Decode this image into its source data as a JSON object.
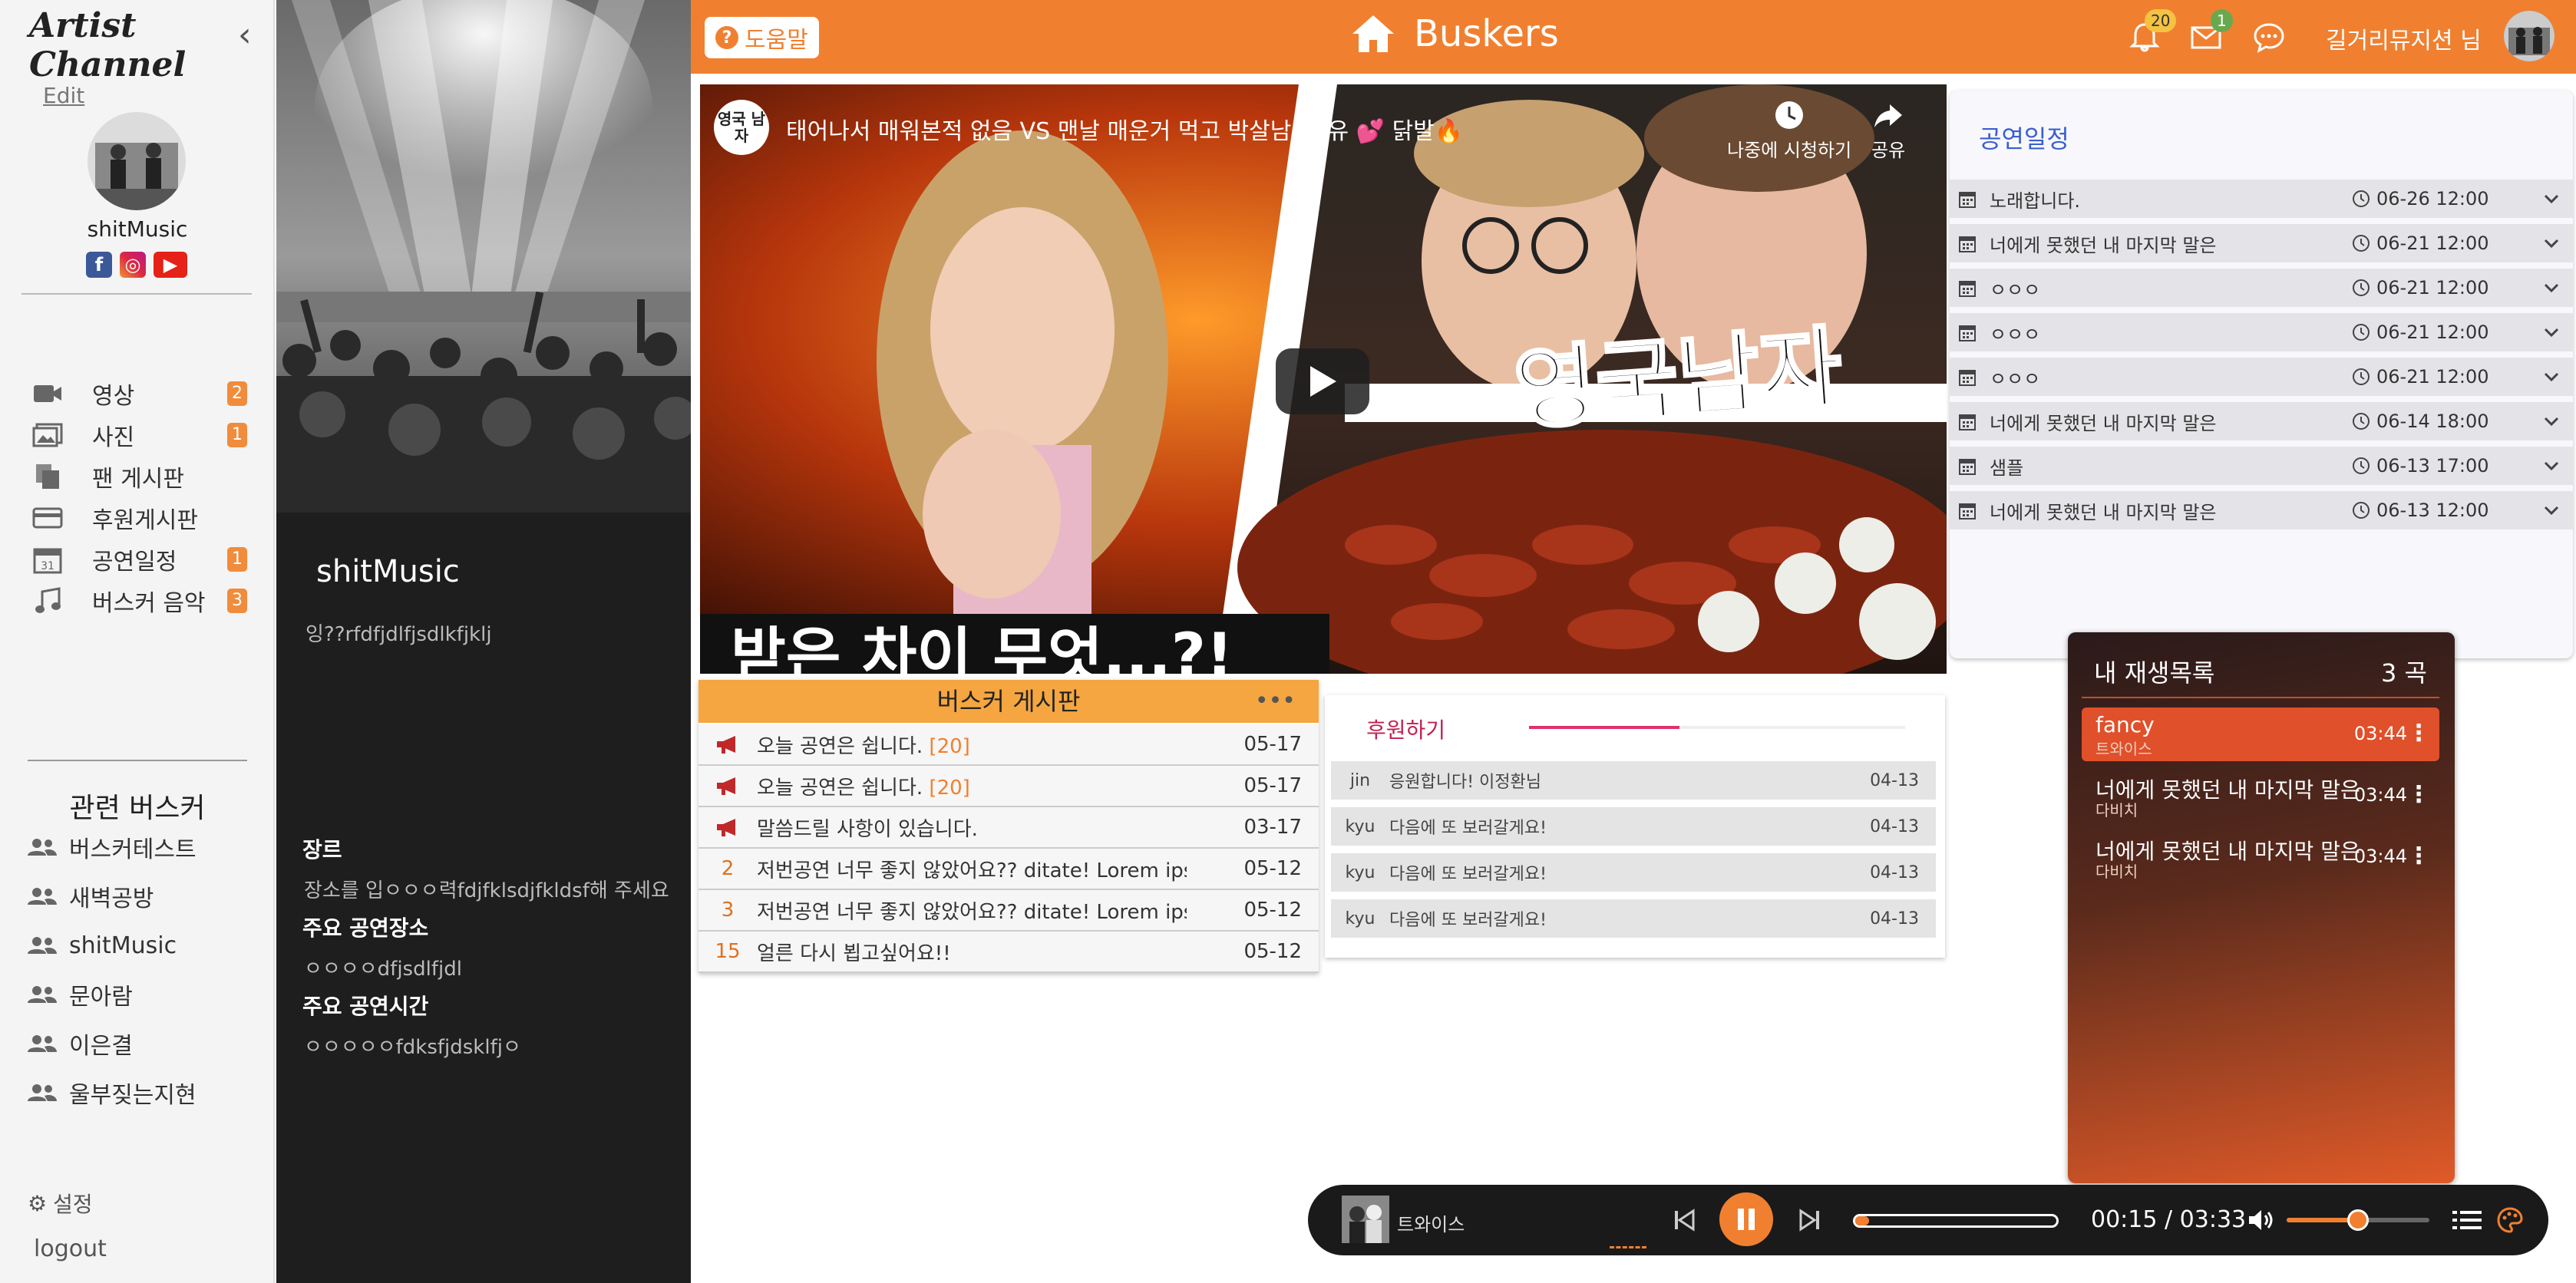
{
  "sidebar": {
    "brand": "Artist Channel",
    "edit": "Edit",
    "artist_name": "shitMusic",
    "menu": [
      {
        "label": "영상",
        "badge": "2",
        "icon": "video-icon"
      },
      {
        "label": "사진",
        "badge": "1",
        "icon": "photo-icon"
      },
      {
        "label": "팬 게시판",
        "badge": "",
        "icon": "copy-icon"
      },
      {
        "label": "후원게시판",
        "badge": "",
        "icon": "card-icon"
      },
      {
        "label": "공연일정",
        "badge": "1",
        "icon": "calendar-icon"
      },
      {
        "label": "버스커 음악",
        "badge": "3",
        "icon": "music-icon"
      }
    ],
    "related_title": "관련 버스커",
    "related": [
      "버스커테스트",
      "새벽공방",
      "shitMusic",
      "문아람",
      "이은결",
      "울부짖는지현"
    ],
    "settings": "설정",
    "logout": "logout"
  },
  "profile": {
    "name": "shitMusic",
    "desc": "잉??rfdfjdlfjsdlkfjklj",
    "genre_label": "장르",
    "genre_value": "장소를 입ㅇㅇㅇ력fdjfklsdjfkldsf해 주세요",
    "venue_label": "주요 공연장소",
    "venue_value": "ㅇㅇㅇㅇdfjsdlfjdl",
    "time_label": "주요 공연시간",
    "time_value": "ㅇㅇㅇㅇㅇfdksfjdsklfjㅇ"
  },
  "header": {
    "help": "도움말",
    "title": "Buskers",
    "notif_count": "20",
    "mail_count": "1",
    "user": "길거리뮤지션 님"
  },
  "video": {
    "channel_logo": "영국 남자",
    "title": "태어나서 매워본적 없음 VS 맨날 매운거 먹고 박살남: 소유 💕 닭발🔥",
    "watch_later": "나중에 시청하기",
    "share": "공유",
    "caption": "받은 차이 무엇...?!",
    "overlay": "영국남자"
  },
  "board": {
    "title": "버스커 게시판",
    "rows": [
      {
        "num": "",
        "notice": true,
        "title": "오늘 공연은 쉽니다.",
        "comments": "[20]",
        "date": "05-17"
      },
      {
        "num": "",
        "notice": true,
        "title": "오늘 공연은 쉽니다.",
        "comments": "[20]",
        "date": "05-17"
      },
      {
        "num": "",
        "notice": true,
        "title": "말씀드릴 사항이 있습니다.",
        "comments": "",
        "date": "03-17"
      },
      {
        "num": "2",
        "notice": false,
        "title": "저번공연 너무 좋지 않았어요?? ditate! Lorem ipsum dolor",
        "comments": "",
        "date": "05-12"
      },
      {
        "num": "3",
        "notice": false,
        "title": "저번공연 너무 좋지 않았어요?? ditate! Lorem ipsum dolor",
        "comments": "",
        "date": "05-12"
      },
      {
        "num": "15",
        "notice": false,
        "title": "얼른 다시 뵙고싶어요!!",
        "comments": "",
        "date": "05-12"
      }
    ]
  },
  "donate": {
    "title": "후원하기",
    "rows": [
      {
        "user": "jin",
        "msg": "응원합니다! 이정환님",
        "date": "04-13"
      },
      {
        "user": "kyu",
        "msg": "다음에 또 보러갈게요!",
        "date": "04-13"
      },
      {
        "user": "kyu",
        "msg": "다음에 또 보러갈게요!",
        "date": "04-13"
      },
      {
        "user": "kyu",
        "msg": "다음에 또 보러갈게요!",
        "date": "04-13"
      }
    ]
  },
  "schedule": {
    "title": "공연일정",
    "rows": [
      {
        "name": "노래합니다.",
        "time": "06-26 12:00"
      },
      {
        "name": "너에게 못했던 내 마지막 말은",
        "time": "06-21 12:00"
      },
      {
        "name": "ㅇㅇㅇ",
        "time": "06-21 12:00"
      },
      {
        "name": "ㅇㅇㅇ",
        "time": "06-21 12:00"
      },
      {
        "name": "ㅇㅇㅇ",
        "time": "06-21 12:00"
      },
      {
        "name": "너에게 못했던 내 마지막 말은",
        "time": "06-14 18:00"
      },
      {
        "name": "샘플",
        "time": "06-13 17:00"
      },
      {
        "name": "너에게 못했던 내 마지막 말은",
        "time": "06-13 12:00"
      }
    ]
  },
  "playlist": {
    "title": "내 재생목록",
    "count": "3 곡",
    "items": [
      {
        "song": "fancy",
        "artist": "트와이스",
        "time": "03:44",
        "active": true
      },
      {
        "song": "너에게 못했던 내 마지막 말은",
        "artist": "다비치",
        "time": "03:44",
        "active": false
      },
      {
        "song": "너에게 못했던 내 마지막 말은",
        "artist": "다비치",
        "time": "03:44",
        "active": false
      }
    ]
  },
  "player": {
    "artist": "트와이스",
    "current": "00:15",
    "sep": "/",
    "total": "03:33",
    "progress": 0.07,
    "volume": 0.5
  },
  "colors": {
    "accent": "#f08030",
    "sidebar": "#f4f4f4",
    "panel": "#1e1e1e"
  }
}
